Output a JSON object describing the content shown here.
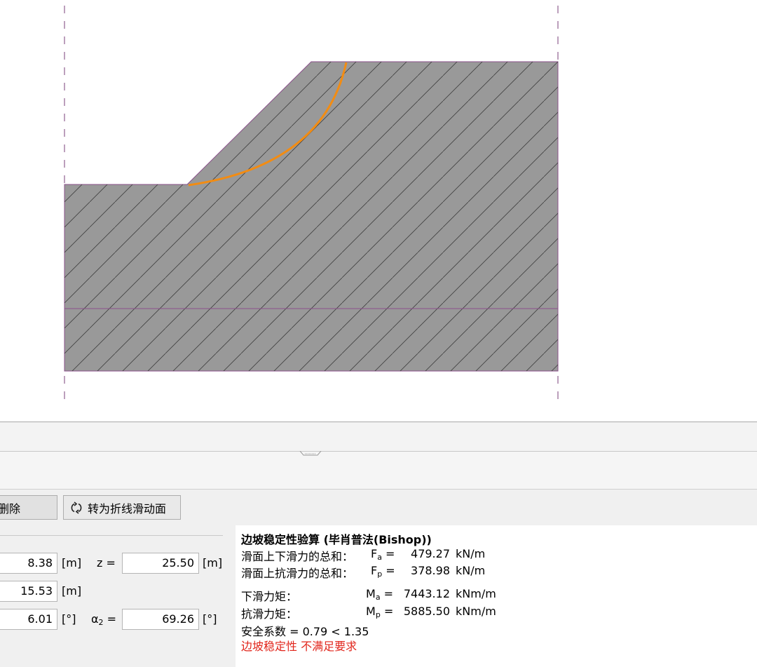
{
  "toolbar": {
    "delete_label": "删除",
    "convert_label": "转为折线滑动面"
  },
  "inputs": {
    "row1": {
      "value1": "8.38",
      "unit1": "[m]",
      "label2": "z =",
      "value2": "25.50",
      "unit2": "[m]"
    },
    "row2": {
      "value1": "15.53",
      "unit1": "[m]"
    },
    "row3": {
      "value1": "6.01",
      "unit1": "[°]",
      "label2": "α",
      "label2_sub": "2",
      "label2_eq": "=",
      "value2": "69.26",
      "unit2": "[°]"
    }
  },
  "results": {
    "title": "边坡稳定性验算 (毕肖普法(Bishop))",
    "rows": [
      {
        "label": "滑面上下滑力的总和：",
        "sym": "F",
        "sub": "a",
        "eq": "=",
        "value": "479.27",
        "unit": "kN/m"
      },
      {
        "label": "滑面上抗滑力的总和：",
        "sym": "F",
        "sub": "p",
        "eq": "=",
        "value": "378.98",
        "unit": "kN/m"
      },
      {
        "label": "下滑力矩：",
        "sym": "M",
        "sub": "a",
        "eq": "=",
        "value": "7443.12",
        "unit": "kNm/m"
      },
      {
        "label": "抗滑力矩：",
        "sym": "M",
        "sub": "p",
        "eq": "=",
        "value": "5885.50",
        "unit": "kNm/m"
      }
    ],
    "safety": "安全系数 = 0.79 < 1.35",
    "verdict": "边坡稳定性 不满足要求"
  },
  "colors": {
    "soil": "#999999",
    "slip_surface": "#f28c13",
    "layer_line": "#8a4f8a",
    "verdict": "#e1251b"
  },
  "icons": {
    "convert": "rotate-arrows-icon"
  }
}
